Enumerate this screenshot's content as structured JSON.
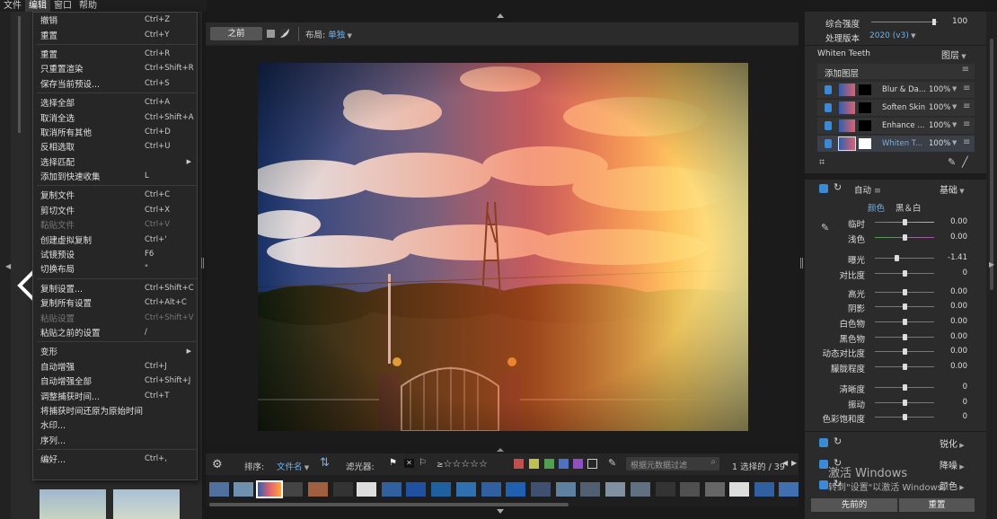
{
  "menubar": {
    "items": [
      "文件",
      "编辑",
      "窗口",
      "帮助"
    ]
  },
  "edit_menu": {
    "items": [
      {
        "label": "撤销",
        "shortcut": "Ctrl+Z"
      },
      {
        "label": "重置",
        "shortcut": "Ctrl+Y"
      },
      {
        "sep": true
      },
      {
        "label": "重置",
        "shortcut": "Ctrl+R"
      },
      {
        "label": "只重置渲染",
        "shortcut": "Ctrl+Shift+R"
      },
      {
        "label": "保存当前预设...",
        "shortcut": "Ctrl+S"
      },
      {
        "sep": true
      },
      {
        "label": "选择全部",
        "shortcut": "Ctrl+A"
      },
      {
        "label": "取消全选",
        "shortcut": "Ctrl+Shift+A"
      },
      {
        "label": "取消所有其他",
        "shortcut": "Ctrl+D"
      },
      {
        "label": "反相选取",
        "shortcut": "Ctrl+U"
      },
      {
        "label": "选择匹配",
        "shortcut": "",
        "arrow": true
      },
      {
        "label": "添加到快速收集",
        "shortcut": "L"
      },
      {
        "sep": true
      },
      {
        "label": "复制文件",
        "shortcut": "Ctrl+C"
      },
      {
        "label": "剪切文件",
        "shortcut": "Ctrl+X"
      },
      {
        "label": "黏贴文件",
        "shortcut": "Ctrl+V",
        "disabled": true
      },
      {
        "label": "创建虚拟复制",
        "shortcut": "Ctrl+'"
      },
      {
        "label": "试镜预设",
        "shortcut": "F6"
      },
      {
        "label": "切换布局",
        "shortcut": "\""
      },
      {
        "sep": true
      },
      {
        "label": "复制设置...",
        "shortcut": "Ctrl+Shift+C"
      },
      {
        "label": "复制所有设置",
        "shortcut": "Ctrl+Alt+C"
      },
      {
        "label": "粘贴设置",
        "shortcut": "Ctrl+Shift+V",
        "disabled": true
      },
      {
        "label": "粘贴之前的设置",
        "shortcut": "/"
      },
      {
        "sep": true
      },
      {
        "label": "变形",
        "shortcut": "",
        "arrow": true
      },
      {
        "label": "自动增强",
        "shortcut": "Ctrl+J"
      },
      {
        "label": "自动增强全部",
        "shortcut": "Ctrl+Shift+J"
      },
      {
        "label": "调整捕获时间...",
        "shortcut": "Ctrl+T"
      },
      {
        "label": "将捕获时间还原为原始时间",
        "shortcut": ""
      },
      {
        "label": "水印...",
        "shortcut": ""
      },
      {
        "label": "序列...",
        "shortcut": ""
      },
      {
        "sep": true
      },
      {
        "label": "编好...",
        "shortcut": "Ctrl+,"
      }
    ]
  },
  "toolbar": {
    "before_label": "之前",
    "layout_label": "布局:",
    "layout_value": "单独"
  },
  "filmstrip_bar": {
    "sort_label": "排序:",
    "sort_value": "文件名",
    "filter_label": "滤光器:",
    "rating_prefix": "≥",
    "stars": "☆☆☆☆☆",
    "search_placeholder": "根据元数据过滤",
    "selection": "1 选择的 / 39"
  },
  "color_labels": [
    "#c05050",
    "#c0c050",
    "#50a050",
    "#5070c0",
    "#9050c0"
  ],
  "right": {
    "intensity_label": "综合强度",
    "intensity_value": "100",
    "version_label": "处理版本",
    "version_value": "2020 (v3)",
    "preset_name": "Whiten Teeth",
    "layers_title": "图层",
    "add_layer": "添加图层",
    "layers": [
      {
        "name": "Blur & Da...",
        "opacity": "100%"
      },
      {
        "name": "Soften Skin",
        "opacity": "100%"
      },
      {
        "name": "Enhance ...",
        "opacity": "100%"
      },
      {
        "name": "Whiten T...",
        "opacity": "100%"
      }
    ],
    "auto_label": "自动",
    "basic_label": "基础",
    "color_tab": "颜色",
    "bw_tab": "黑＆白",
    "sliders": [
      {
        "label": "临时",
        "value": "0.00",
        "pos": 0.5,
        "kind": "temp"
      },
      {
        "label": "浅色",
        "value": "0.00",
        "pos": 0.5,
        "kind": "tint"
      },
      {
        "label": "曝光",
        "value": "-1.41",
        "pos": 0.36,
        "kind": "plain"
      },
      {
        "label": "对比度",
        "value": "0",
        "pos": 0.5,
        "kind": "plain"
      },
      {
        "label": "高光",
        "value": "0.00",
        "pos": 0.5,
        "kind": "plain"
      },
      {
        "label": "阴影",
        "value": "0.00",
        "pos": 0.5,
        "kind": "plain"
      },
      {
        "label": "白色物",
        "value": "0.00",
        "pos": 0.5,
        "kind": "plain"
      },
      {
        "label": "黑色物",
        "value": "0.00",
        "pos": 0.5,
        "kind": "plain"
      },
      {
        "label": "动态对比度",
        "value": "0.00",
        "pos": 0.5,
        "kind": "plain"
      },
      {
        "label": "朦胧程度",
        "value": "0.00",
        "pos": 0.5,
        "kind": "plain"
      },
      {
        "label": "清晰度",
        "value": "0",
        "pos": 0.5,
        "kind": "plain"
      },
      {
        "label": "振动",
        "value": "0",
        "pos": 0.5,
        "kind": "plain"
      },
      {
        "label": "色彩饱和度",
        "value": "0",
        "pos": 0.5,
        "kind": "plain"
      }
    ],
    "sharpen_label": "锐化",
    "noise_label": "降噪",
    "color_label": "颜色",
    "prev_button": "先前的",
    "reset_button": "重置"
  },
  "watermark": {
    "line1": "激活 Windows",
    "line2": "转到\"设置\"以激活 Windows。"
  }
}
